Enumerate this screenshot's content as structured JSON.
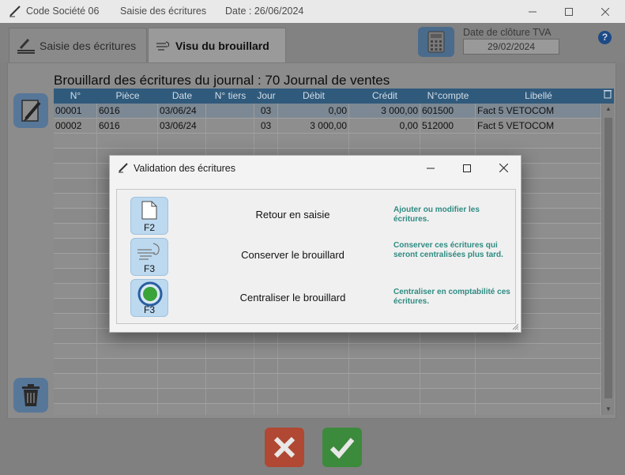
{
  "window": {
    "company": "Code Société 06",
    "module": "Saisie des écritures",
    "date": "Date : 26/06/2024",
    "controls": [
      "minimize",
      "maximize",
      "close"
    ]
  },
  "tabs": [
    {
      "label": "Saisie des écritures",
      "active": false
    },
    {
      "label": "Visu du brouillard",
      "active": true
    }
  ],
  "tva": {
    "label": "Date de clôture TVA",
    "value": "29/02/2024"
  },
  "help_label": "?",
  "journal_title": "Brouillard des écritures du journal : 70 Journal de ventes",
  "grid": {
    "columns": [
      "N°",
      "Pièce",
      "Date",
      "N° tiers",
      "Jour",
      "Débit",
      "Crédit",
      "N°compte",
      "Libellé"
    ],
    "rows": [
      [
        "00001",
        "6016",
        "03/06/24",
        "",
        "03",
        "0,00",
        "3 000,00",
        "601500",
        "Fact 5 VETOCOM"
      ],
      [
        "00002",
        "6016",
        "03/06/24",
        "",
        "03",
        "3 000,00",
        "0,00",
        "512000",
        "Fact 5 VETOCOM"
      ]
    ]
  },
  "modal": {
    "title": "Validation des écritures",
    "actions": [
      {
        "key": "F2",
        "label": "Retour en saisie",
        "desc": "Ajouter ou modifier les écritures.",
        "icon": "document-icon"
      },
      {
        "key": "F3",
        "label": "Conserver le brouillard",
        "desc": "Conserver ces écritures qui seront centralisées plus tard.",
        "icon": "wind-icon"
      },
      {
        "key": "F3",
        "label": "Centraliser le brouillard",
        "desc": "Centraliser en comptabilité ces écritures.",
        "icon": "target-icon"
      }
    ]
  },
  "colors": {
    "header": "#2f5a7c",
    "accent_desc": "#2e8b82",
    "cancel": "#b04833",
    "ok": "#3c8a3c",
    "key_bg": "#bcd9f0"
  }
}
